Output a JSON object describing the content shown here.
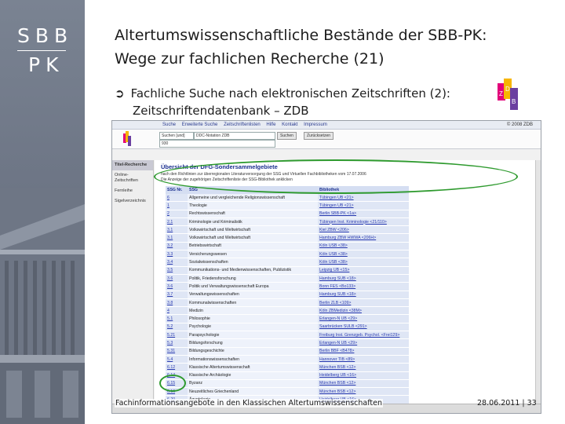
{
  "logo": {
    "line1": "SBB",
    "line2": "PK"
  },
  "slide": {
    "title_line1": "Altertumswissenschaftliche Bestände der SBB-PK:",
    "title_line2": "Wege zur fachlichen Recherche (21)",
    "bullet_line1": "Fachliche Suche nach elektronischen Zeitschriften (2):",
    "bullet_line2": "Zeitschriftendatenbank – ZDB",
    "footer_left": "Fachinformationsangebote in den Klassischen Altertumswissenschaften",
    "footer_right": "28.06.2011 | 33"
  },
  "zdb_logo": {
    "letters": [
      "Z",
      "D",
      "B"
    ],
    "colors": [
      "#e2007a",
      "#f7b500",
      "#6b3fa0"
    ]
  },
  "screenshot": {
    "menu": [
      "Suche",
      "Erweiterte Suche",
      "Zeitschriftenlisten",
      "Hilfe",
      "Kontakt",
      "Impressum"
    ],
    "menu_right": "© 2008 ZDB",
    "left_nav": [
      {
        "label": "Titel-Recherche",
        "active": true
      },
      {
        "label": "Online-Zeitschriften",
        "active": false
      },
      {
        "label": "Fernleihe",
        "active": false
      },
      {
        "label": "Sigelverzeichnis",
        "active": false
      }
    ],
    "search": {
      "field_select": "Suchen [und]",
      "notation_select": "DDC-Notation ZDB",
      "value_input": "930",
      "submit_label": "Suchen",
      "reset_label": "Zurücksetzen"
    },
    "content_title": "Übersicht der DFG-Sondersammelgebiete",
    "note_line1": "nach den Richtlinien zur überregionalen Literaturversorgung der SSG und Virtuellen Fachbibliotheken vom 17.07.2006",
    "note_line2": "Die Anzeige der zugehörigen Zeitschriftenliste der SSG-Bibliothek anklicken",
    "table_headers": [
      "SSG Nr.",
      "SSG",
      "Bibliothek"
    ],
    "table_rows": [
      [
        "6",
        "Allgemeine und vergleichende Religionswissenschaft",
        "Tübingen UB <21>"
      ],
      [
        "1",
        "Theologie",
        "Tübingen UB <21>"
      ],
      [
        "2",
        "Rechtswissenschaft",
        "Berlin SBB-PK <1a>"
      ],
      [
        "2.1",
        "Kriminologie und Kriminalistik",
        "Tübingen Inst. Kriminologie <21/110>"
      ],
      [
        "3.1",
        "Volkswirtschaft und Weltwirtschaft",
        "Kiel ZBW <206>"
      ],
      [
        "3.1",
        "Volkswirtschaft und Weltwirtschaft",
        "Hamburg ZBW HWWA <206H>"
      ],
      [
        "3.2",
        "Betriebswirtschaft",
        "Köln USB <38>"
      ],
      [
        "3.3",
        "Versicherungswesen",
        "Köln USB <38>"
      ],
      [
        "3.4",
        "Sozialwissenschaften",
        "Köln USB <38>"
      ],
      [
        "3.5",
        "Kommunikations- und Medienwissenschaften, Publizistik",
        "Leipzig UB <15>"
      ],
      [
        "3.6",
        "Politik, Friedensforschung",
        "Hamburg SUB <18>"
      ],
      [
        "3.6",
        "Politik und Verwaltungswissenschaft Europa",
        "Bonn FES <Bo133>"
      ],
      [
        "3.7",
        "Verwaltungswissenschaften",
        "Hamburg SUB <18>"
      ],
      [
        "3.8",
        "Kommunalwissenschaften",
        "Berlin ZLB <109>"
      ],
      [
        "4",
        "Medizin",
        "Köln ZBMedizin <38M>"
      ],
      [
        "5.1",
        "Philosophie",
        "Erlangen-N UB <29>"
      ],
      [
        "5.2",
        "Psychologie",
        "Saarbrücken SULB <291>"
      ],
      [
        "5.21",
        "Parapsychologie",
        "Freiburg Inst. Grenzgeb. Psychol. <Frei129>"
      ],
      [
        "5.3",
        "Bildungsforschung",
        "Erlangen-N UB <29>"
      ],
      [
        "5.31",
        "Bildungsgeschichte",
        "Berlin BBF <B478>"
      ],
      [
        "5.4",
        "Informationswissenschaften",
        "Hannover TIB <89>"
      ],
      [
        "6.12",
        "Klassische Altertumswissenschaft",
        "München BSB <12>"
      ],
      [
        "6.14",
        "Klassische Archäologie",
        "Heidelberg UB <16>"
      ],
      [
        "6.15",
        "Byzanz",
        "München BSB <12>"
      ],
      [
        "6.16",
        "Neuzeitliches Griechenland",
        "München BSB <12>"
      ],
      [
        "6.20",
        "Ägyptologie",
        "Heidelberg UB <16>"
      ],
      [
        "6.21",
        "Alter Orient",
        "Tübingen UB <21>"
      ]
    ]
  }
}
